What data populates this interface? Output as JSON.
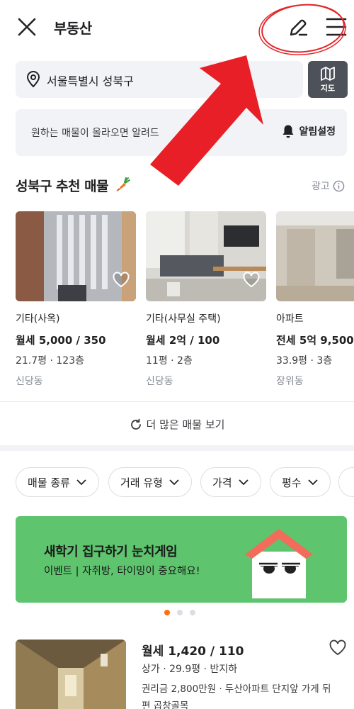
{
  "header": {
    "title": "부동산",
    "close_icon": "close-icon",
    "edit_icon": "pencil-icon",
    "menu_icon": "hamburger-menu-icon"
  },
  "location": {
    "value": "서울특별시 성북구",
    "map_button_label": "지도"
  },
  "alert": {
    "text": "원하는 매물이 올라오면 알려드",
    "setting_label": "알림설정"
  },
  "recommend": {
    "title": "성북구 추천 매물",
    "ad_label": "광고",
    "cards": [
      {
        "type": "기타(사옥)",
        "price": "월세 5,000 / 350",
        "size": "21.7평 · 123층",
        "area": "신당동"
      },
      {
        "type": "기타(사무실 주택)",
        "price": "월세 2억 / 100",
        "size": "11평 · 2층",
        "area": "신당동"
      },
      {
        "type": "아파트",
        "price": "전세 5억 9,500",
        "size": "33.9평 · 3층",
        "area": "장위동"
      }
    ],
    "more_label": "더 많은 매물 보기"
  },
  "filters": [
    {
      "label": "매물 종류"
    },
    {
      "label": "거래 유형"
    },
    {
      "label": "가격"
    },
    {
      "label": "평수"
    }
  ],
  "banner": {
    "title": "새학기 집구하기 눈치게임",
    "subtitle": "이벤트 | 자취방, 타이밍이 중요해요!",
    "slide_count": 3,
    "active_slide": 1
  },
  "listing": {
    "price": "월세 1,420 / 110",
    "meta": "상가 · 29.9평 · 반지하",
    "desc": "권리금 2,800만원 · 두산아파트 단지앞 가게 뒤편 곱창골목"
  },
  "colors": {
    "accent": "#ff6f0f",
    "banner_green": "#5ec46e",
    "annotation_red": "#e3262a"
  }
}
